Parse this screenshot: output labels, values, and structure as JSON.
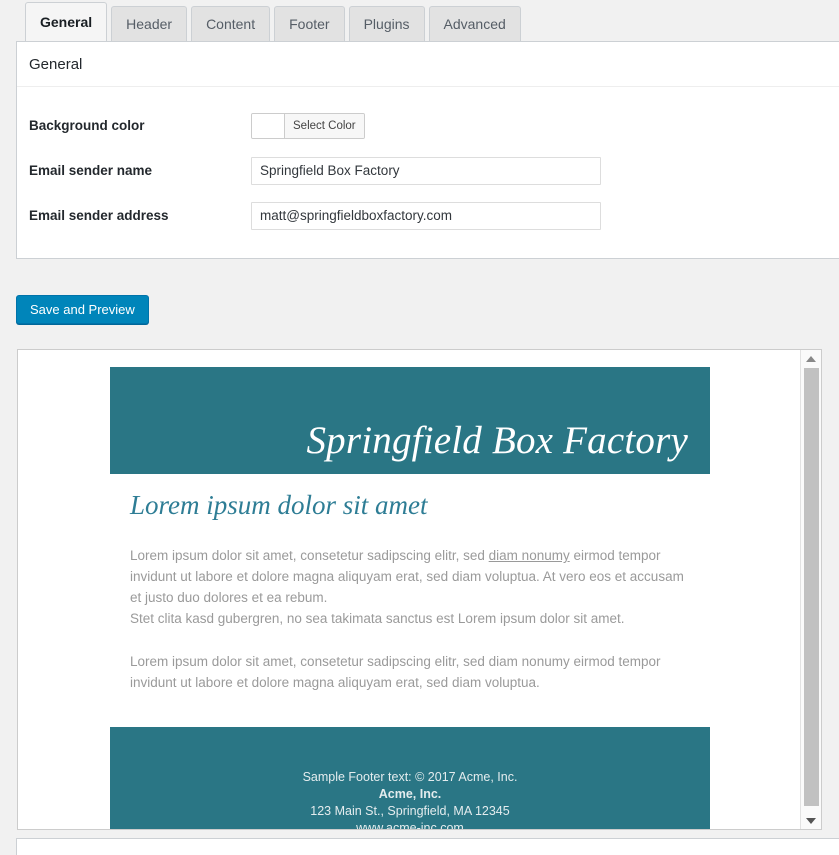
{
  "tabs": [
    {
      "label": "General",
      "active": true
    },
    {
      "label": "Header",
      "active": false
    },
    {
      "label": "Content",
      "active": false
    },
    {
      "label": "Footer",
      "active": false
    },
    {
      "label": "Plugins",
      "active": false
    },
    {
      "label": "Advanced",
      "active": false
    }
  ],
  "settings": {
    "section_title": "General",
    "fields": {
      "background_color": {
        "label": "Background color",
        "button_label": "Select Color",
        "swatch_color": "#ffffff"
      },
      "email_sender_name": {
        "label": "Email sender name",
        "value": "Springfield Box Factory",
        "placeholder": ""
      },
      "email_sender_address": {
        "label": "Email sender address",
        "value": "matt@springfieldboxfactory.com",
        "placeholder": ""
      }
    }
  },
  "actions": {
    "save_preview_label": "Save and Preview"
  },
  "preview": {
    "header_title": "Springfield Box Factory",
    "heading": "Lorem ipsum dolor sit amet",
    "paragraph1_before_link": "Lorem ipsum dolor sit amet, consetetur sadipscing elitr, sed ",
    "paragraph1_link": "diam nonumy",
    "paragraph1_after_link": " eirmod tempor invidunt ut labore et dolore magna aliquyam erat, sed diam voluptua. At vero eos et accusam et justo duo dolores et ea rebum.",
    "paragraph1_line4": "Stet clita kasd gubergren, no sea takimata sanctus est Lorem ipsum dolor sit amet.",
    "paragraph2": "Lorem ipsum dolor sit amet, consetetur sadipscing elitr, sed diam nonumy eirmod tempor invidunt ut labore et dolore magna aliquyam erat, sed diam voluptua.",
    "footer": {
      "line1": "Sample Footer text: © 2017 Acme, Inc.",
      "line2": "Acme, Inc.",
      "line3": "123 Main St., Springfield, MA 12345",
      "line4": "www.acme-inc.com"
    },
    "colors": {
      "banner": "#2a7685",
      "heading": "#2e7d95",
      "body_text": "#9a9a9a"
    }
  },
  "scrollbar": {
    "up_icon": "triangle-up-icon",
    "down_icon": "triangle-down-icon"
  }
}
